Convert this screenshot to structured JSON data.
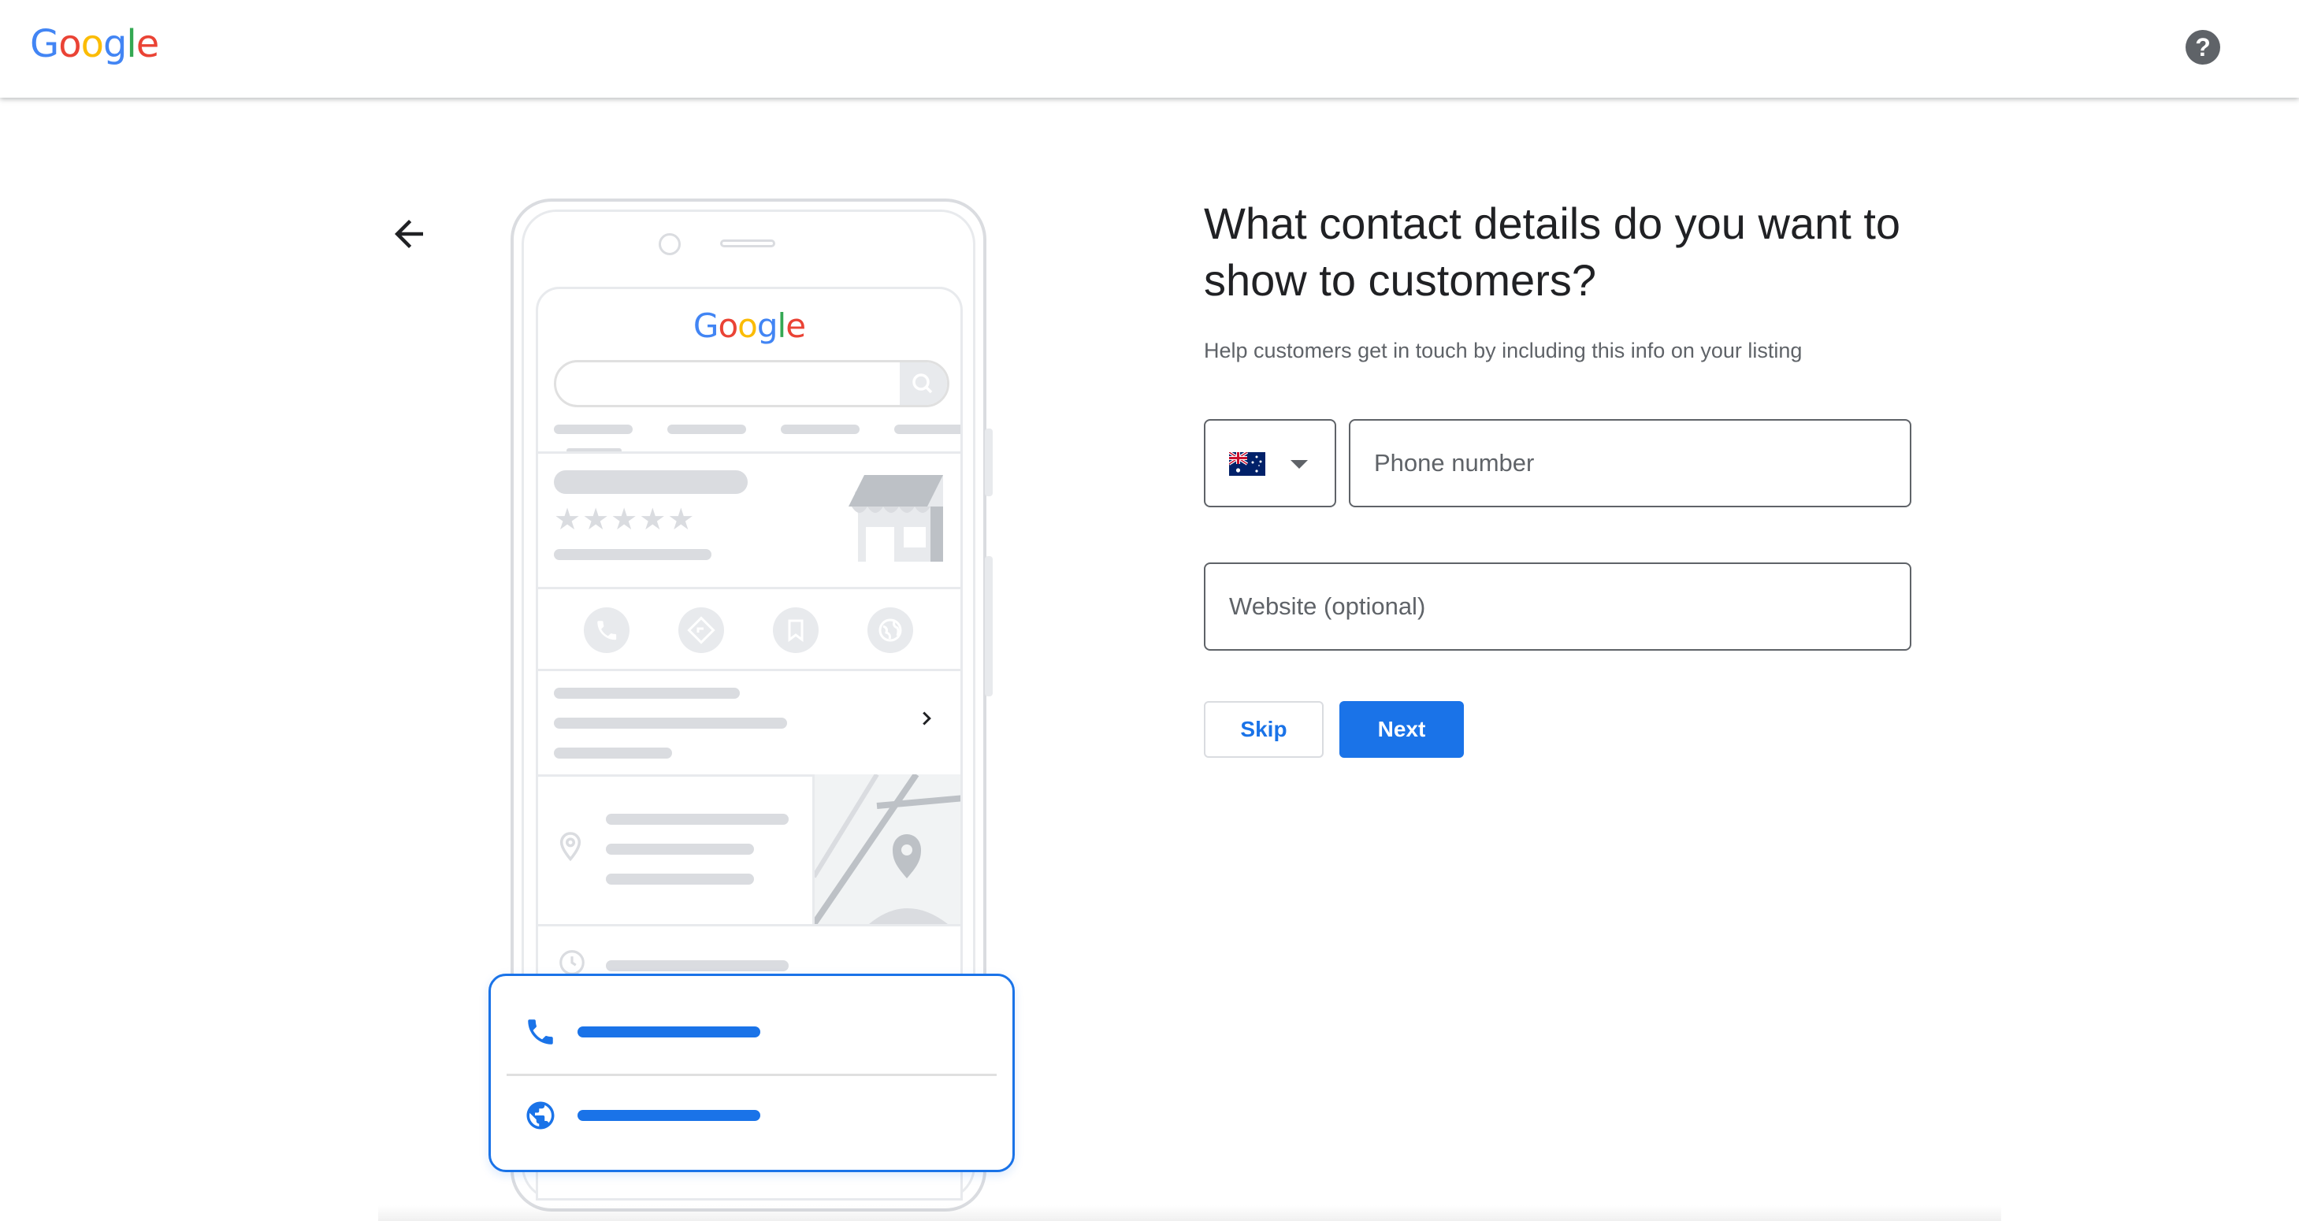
{
  "header": {
    "logo_letters": [
      {
        "ch": "G",
        "color": "#4285F4"
      },
      {
        "ch": "o",
        "color": "#EA4335"
      },
      {
        "ch": "o",
        "color": "#FBBC05"
      },
      {
        "ch": "g",
        "color": "#4285F4"
      },
      {
        "ch": "l",
        "color": "#34A853"
      },
      {
        "ch": "e",
        "color": "#EA4335"
      }
    ],
    "help_icon": "?"
  },
  "illustration": {
    "screen_logo": "Google"
  },
  "form": {
    "title": "What contact details do you want to show to customers?",
    "subtitle": "Help customers get in touch by including this info on your listing",
    "country_flag": "australia-flag-icon",
    "phone_placeholder": "Phone number",
    "phone_value": "",
    "website_placeholder": "Website (optional)",
    "website_value": "",
    "skip_label": "Skip",
    "next_label": "Next"
  },
  "colors": {
    "accent": "#1a73e8",
    "icon_gray": "#5f6368",
    "placeholder_gray": "#dadce0"
  }
}
